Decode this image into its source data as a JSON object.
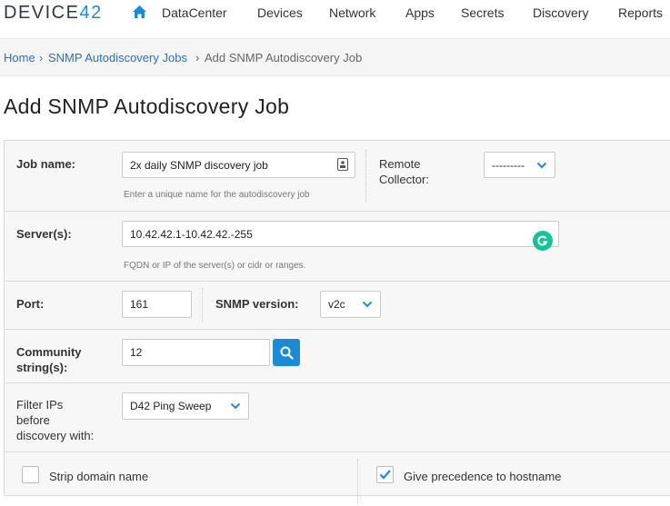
{
  "brand": {
    "logo_prefix": "DEVICE",
    "logo_suffix": "42",
    "accent": "#1a8cd8"
  },
  "nav": {
    "home_icon": "home-icon",
    "items": [
      "DataCenter",
      "Devices",
      "Network",
      "Apps",
      "Secrets",
      "Discovery",
      "Reports"
    ]
  },
  "breadcrumb": {
    "home": "Home",
    "sep": "›",
    "parent": "SNMP Autodiscovery Jobs",
    "current": "Add SNMP Autodiscovery Job"
  },
  "page": {
    "title": "Add SNMP Autodiscovery Job"
  },
  "form": {
    "job_name": {
      "label": "Job name:",
      "value": "2x daily SNMP discovery job",
      "help": "Enter a unique name for the autodiscovery job"
    },
    "remote_collector": {
      "label_line1": "Remote",
      "label_line2": "Collector:",
      "value": "---------"
    },
    "servers": {
      "label": "Server(s):",
      "value": "10.42.42.1-10.42.42.-255",
      "help": "FQDN or IP of the server(s) or cidr or ranges."
    },
    "port": {
      "label": "Port:",
      "value": "161"
    },
    "snmp_version": {
      "label": "SNMP version:",
      "value": "v2c"
    },
    "community": {
      "label_line1": "Community",
      "label_line2": "string(s):",
      "value": "12"
    },
    "filter_ips": {
      "label_line1": "Filter IPs",
      "label_line2": "before",
      "label_line3": "discovery with:",
      "value": "D42 Ping Sweep"
    },
    "strip_domain": {
      "label": "Strip domain name",
      "checked": false
    },
    "hostname_precedence": {
      "label": "Give precedence to hostname",
      "checked": true
    }
  },
  "colors": {
    "search_button": "#1d8ad6",
    "grammarly": "#15c39a",
    "link": "#2f6fb3"
  }
}
